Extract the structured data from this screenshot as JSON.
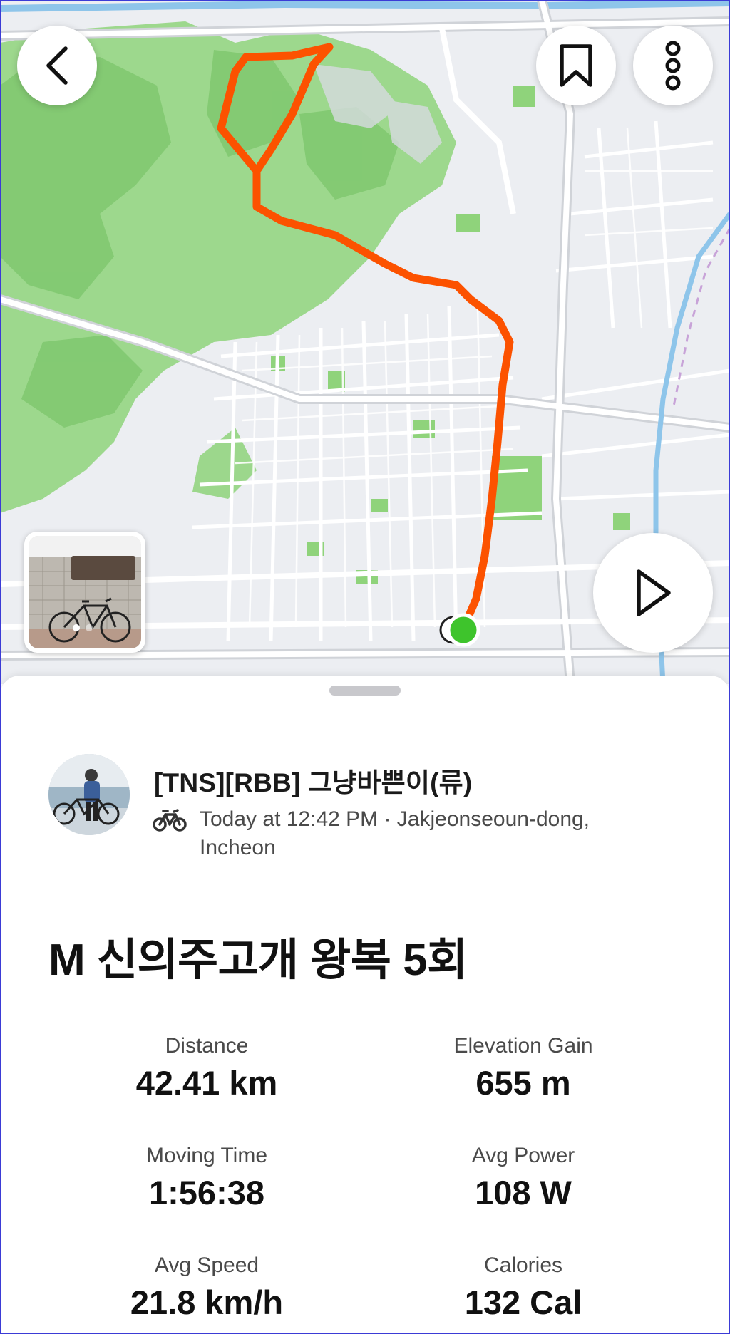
{
  "map": {
    "route_color": "#fc5200",
    "end_marker_color": "#3ec42c",
    "park_color": "#8fd37b"
  },
  "header": {
    "back_icon": "chevron-left-icon",
    "bookmark_icon": "bookmark-icon",
    "more_icon": "more-vertical-icon",
    "play_icon": "play-icon"
  },
  "activity": {
    "athlete_name": "[TNS][RBB] 그냥바쁜이(류)",
    "sport_icon": "bike-icon",
    "meta": "Today at 12:42 PM · Jakjeonseoun-dong, Incheon",
    "title": "M 신의주고개 왕복 5회"
  },
  "stats": [
    {
      "label": "Distance",
      "value": "42.41 km"
    },
    {
      "label": "Elevation Gain",
      "value": "655 m"
    },
    {
      "label": "Moving Time",
      "value": "1:56:38"
    },
    {
      "label": "Avg Power",
      "value": "108 W"
    },
    {
      "label": "Avg Speed",
      "value": "21.8 km/h"
    },
    {
      "label": "Calories",
      "value": "132 Cal"
    }
  ]
}
